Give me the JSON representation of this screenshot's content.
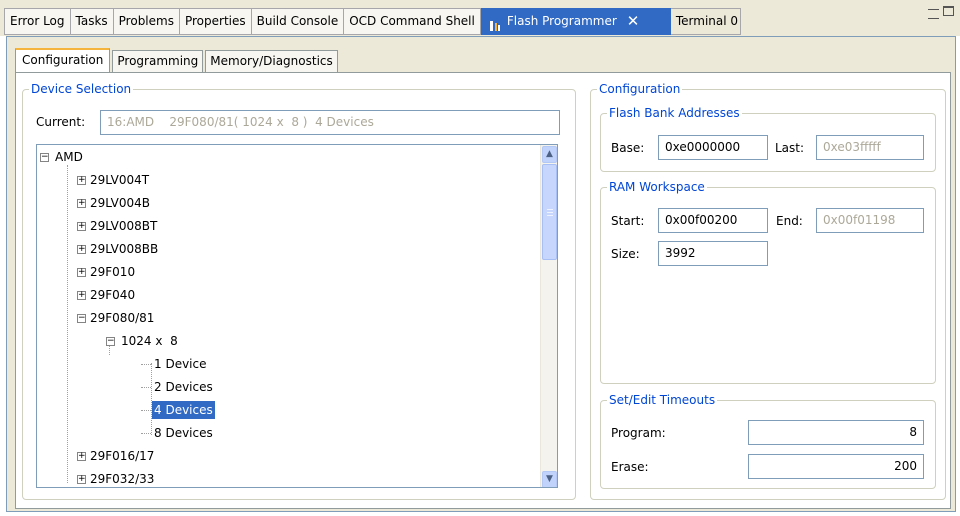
{
  "view_tabs": [
    "Error Log",
    "Tasks",
    "Problems",
    "Properties",
    "Build Console",
    "OCD Command Shell"
  ],
  "active_view_tab": "Flash Programmer",
  "terminal_tab": "Terminal 0",
  "sub_tabs": [
    "Configuration",
    "Programming",
    "Memory/Diagnostics"
  ],
  "device_selection": {
    "legend": "Device Selection",
    "current_label": "Current:",
    "current_value": "16:AMD    29F080/81( 1024 x  8 )  4 Devices",
    "tree": {
      "root": "AMD",
      "items": [
        "29LV004T",
        "29LV004B",
        "29LV008BT",
        "29LV008BB",
        "29F010",
        "29F040",
        "29F080/81"
      ],
      "sub": "1024 x  8",
      "devices": [
        "1 Device",
        "2 Devices",
        "4 Devices",
        "8 Devices"
      ],
      "after": [
        "29F016/17",
        "29F032/33"
      ]
    }
  },
  "configuration": {
    "legend": "Configuration",
    "flash_bank": {
      "legend": "Flash Bank Addresses",
      "base_label": "Base:",
      "base_value": "0xe0000000",
      "last_label": "Last:",
      "last_value": "0xe03fffff"
    },
    "ram": {
      "legend": "RAM Workspace",
      "start_label": "Start:",
      "start_value": "0x00f00200",
      "end_label": "End:",
      "end_value": "0x00f01198",
      "size_label": "Size:",
      "size_value": "3992"
    },
    "timeouts": {
      "legend": "Set/Edit Timeouts",
      "program_label": "Program:",
      "program_value": "8",
      "erase_label": "Erase:",
      "erase_value": "200"
    }
  },
  "colors": {
    "accent": "#316ac5",
    "legend": "#0046d5",
    "orange_tab": "#f5b43c"
  }
}
